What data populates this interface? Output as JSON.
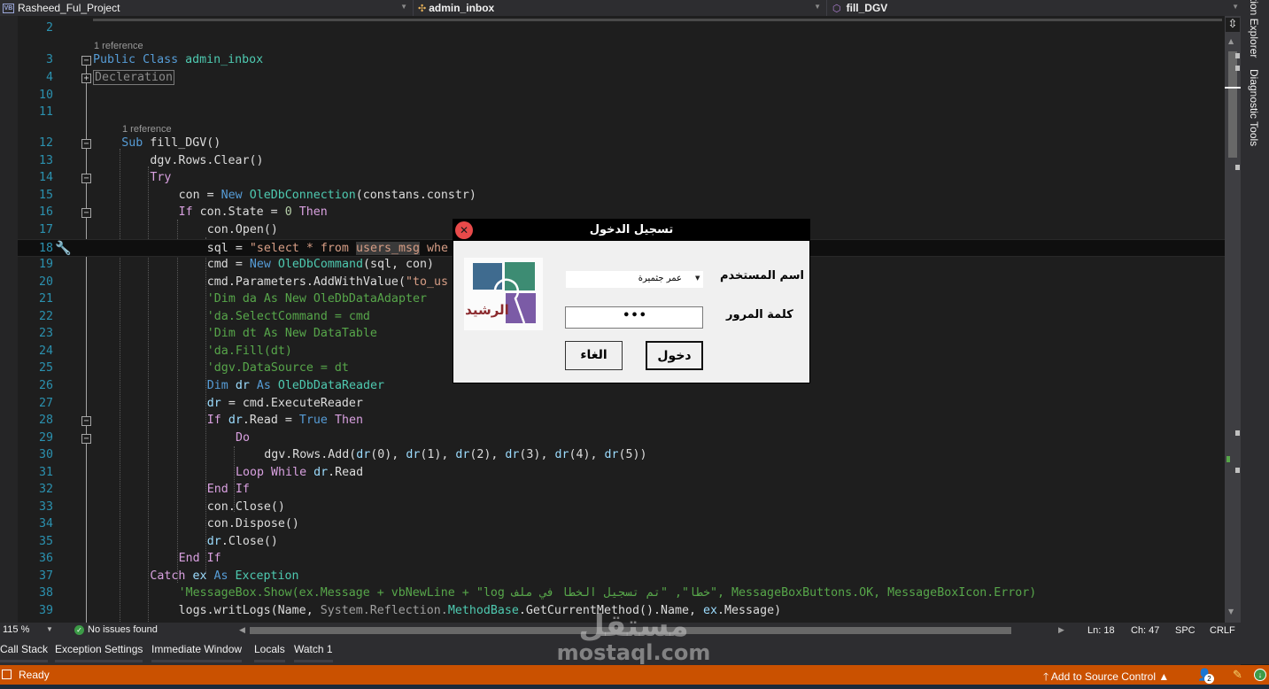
{
  "navbar": {
    "project": "Rasheed_Ful_Project",
    "class": "admin_inbox",
    "member": "fill_DGV"
  },
  "editor": {
    "lens_references": "1 reference",
    "lines": [
      {
        "n": "2"
      },
      {
        "n": "3",
        "tokens": [
          [
            "kw",
            "Public"
          ],
          [
            "plain",
            " "
          ],
          [
            "kw",
            "Class"
          ],
          [
            "plain",
            " "
          ],
          [
            "typ",
            "admin_inbox"
          ]
        ]
      },
      {
        "n": "4",
        "tokens": [
          [
            "collapsed",
            "Decleration"
          ]
        ]
      },
      {
        "n": "10"
      },
      {
        "n": "11"
      },
      {
        "n": "12",
        "tokens": [
          [
            "kw",
            "Sub"
          ],
          [
            "plain",
            " "
          ],
          [
            "plain",
            "fill_DGV()"
          ]
        ]
      },
      {
        "n": "13",
        "tokens": [
          [
            "plain",
            "dgv.Rows.Clear()"
          ]
        ]
      },
      {
        "n": "14",
        "tokens": [
          [
            "ctl",
            "Try"
          ]
        ]
      },
      {
        "n": "15",
        "tokens": [
          [
            "plain",
            "con = "
          ],
          [
            "kw",
            "New"
          ],
          [
            "plain",
            " "
          ],
          [
            "typ",
            "OleDbConnection"
          ],
          [
            "plain",
            "(constans.constr)"
          ]
        ]
      },
      {
        "n": "16",
        "tokens": [
          [
            "ctl",
            "If"
          ],
          [
            "plain",
            " con.State = "
          ],
          [
            "num",
            "0"
          ],
          [
            "plain",
            " "
          ],
          [
            "ctl",
            "Then"
          ]
        ]
      },
      {
        "n": "17",
        "tokens": [
          [
            "plain",
            "con.Open()"
          ]
        ]
      },
      {
        "n": "18",
        "tokens": [
          [
            "plain",
            "sql = "
          ],
          [
            "str",
            "\"select * from "
          ],
          [
            "str hl",
            "users_msg"
          ],
          [
            "str",
            " whe"
          ]
        ]
      },
      {
        "n": "19",
        "tokens": [
          [
            "plain",
            "cmd = "
          ],
          [
            "kw",
            "New"
          ],
          [
            "plain",
            " "
          ],
          [
            "typ",
            "OleDbCommand"
          ],
          [
            "plain",
            "(sql, con)"
          ]
        ]
      },
      {
        "n": "20",
        "tokens": [
          [
            "plain",
            "cmd.Parameters.AddWithValue("
          ],
          [
            "str",
            "\"to_us"
          ]
        ]
      },
      {
        "n": "21",
        "tokens": [
          [
            "cmt",
            "'Dim da As New OleDbDataAdapter"
          ]
        ]
      },
      {
        "n": "22",
        "tokens": [
          [
            "cmt",
            "'da.SelectCommand = cmd"
          ]
        ]
      },
      {
        "n": "23",
        "tokens": [
          [
            "cmt",
            "'Dim dt As New DataTable"
          ]
        ]
      },
      {
        "n": "24",
        "tokens": [
          [
            "cmt",
            "'da.Fill(dt)"
          ]
        ]
      },
      {
        "n": "25",
        "tokens": [
          [
            "cmt",
            "'dgv.DataSource = dt"
          ]
        ]
      },
      {
        "n": "26",
        "tokens": [
          [
            "kw",
            "Dim"
          ],
          [
            "plain",
            " "
          ],
          [
            "id",
            "dr"
          ],
          [
            "plain",
            " "
          ],
          [
            "kw",
            "As"
          ],
          [
            "plain",
            " "
          ],
          [
            "typ",
            "OleDbDataReader"
          ]
        ]
      },
      {
        "n": "27",
        "tokens": [
          [
            "id",
            "dr"
          ],
          [
            "plain",
            " = cmd.ExecuteReader"
          ]
        ]
      },
      {
        "n": "28",
        "tokens": [
          [
            "ctl",
            "If"
          ],
          [
            "plain",
            " "
          ],
          [
            "id",
            "dr"
          ],
          [
            "plain",
            ".Read = "
          ],
          [
            "kw",
            "True"
          ],
          [
            "plain",
            " "
          ],
          [
            "ctl",
            "Then"
          ]
        ]
      },
      {
        "n": "29",
        "tokens": [
          [
            "ctl",
            "Do"
          ]
        ]
      },
      {
        "n": "30",
        "tokens": [
          [
            "plain",
            "dgv.Rows.Add("
          ],
          [
            "id",
            "dr"
          ],
          [
            "plain",
            "(0), "
          ],
          [
            "id",
            "dr"
          ],
          [
            "plain",
            "(1), "
          ],
          [
            "id",
            "dr"
          ],
          [
            "plain",
            "(2), "
          ],
          [
            "id",
            "dr"
          ],
          [
            "plain",
            "(3), "
          ],
          [
            "id",
            "dr"
          ],
          [
            "plain",
            "(4), "
          ],
          [
            "id",
            "dr"
          ],
          [
            "plain",
            "(5))"
          ]
        ]
      },
      {
        "n": "31",
        "tokens": [
          [
            "ctl",
            "Loop"
          ],
          [
            "plain",
            " "
          ],
          [
            "ctl",
            "While"
          ],
          [
            "plain",
            " "
          ],
          [
            "id",
            "dr"
          ],
          [
            "plain",
            ".Read"
          ]
        ]
      },
      {
        "n": "32",
        "tokens": [
          [
            "ctl",
            "End"
          ],
          [
            "plain",
            " "
          ],
          [
            "ctl",
            "If"
          ]
        ]
      },
      {
        "n": "33",
        "tokens": [
          [
            "plain",
            "con.Close()"
          ]
        ]
      },
      {
        "n": "34",
        "tokens": [
          [
            "plain",
            "con.Dispose()"
          ]
        ]
      },
      {
        "n": "35",
        "tokens": [
          [
            "id",
            "dr"
          ],
          [
            "plain",
            ".Close()"
          ]
        ]
      },
      {
        "n": "36",
        "tokens": [
          [
            "ctl",
            "End"
          ],
          [
            "plain",
            " "
          ],
          [
            "ctl",
            "If"
          ]
        ]
      },
      {
        "n": "37",
        "tokens": [
          [
            "ctl",
            "Catch"
          ],
          [
            "plain",
            " "
          ],
          [
            "id",
            "ex"
          ],
          [
            "plain",
            " "
          ],
          [
            "kw",
            "As"
          ],
          [
            "plain",
            " "
          ],
          [
            "typ",
            "Exception"
          ]
        ]
      },
      {
        "n": "38",
        "tokens": [
          [
            "cmt",
            "'MessageBox.Show(ex.Message + vbNewLine + \"log خطا\", \"تم تسجيل الخطا في ملف\", MessageBoxButtons.OK, MessageBoxIcon.Error)"
          ]
        ]
      },
      {
        "n": "39",
        "tokens": [
          [
            "plain",
            "logs.writLogs(Name, "
          ],
          [
            "grey",
            "System.Reflection."
          ],
          [
            "typ",
            "MethodBase"
          ],
          [
            "plain",
            ".GetCurrentMethod().Name, "
          ],
          [
            "id",
            "ex"
          ],
          [
            "plain",
            ".Message)"
          ]
        ]
      }
    ]
  },
  "side_tabs": {
    "solution_explorer": "tion Explorer",
    "diagnostic_tools": "Diagnostic Tools"
  },
  "editor_bottom": {
    "zoom": "115 %",
    "issues": "No issues found",
    "line": "Ln: 18",
    "char": "Ch: 47",
    "indent": "SPC",
    "line_ending": "CRLF"
  },
  "tool_tabs": [
    "Call Stack",
    "Exception Settings",
    "Immediate Window",
    "Locals",
    "Watch 1"
  ],
  "statusbar": {
    "ready": "Ready",
    "source_control": "Add to Source Control",
    "notifications_count": "2",
    "accent": "#ca5100"
  },
  "dialog": {
    "title": "تسجيل الدخول",
    "close_glyph": "✕",
    "logo_text": "الرشيد",
    "username_label": "اسم المستخدم",
    "username_value": "عمر جثميرة",
    "password_label": "كلمة المرور",
    "password_value": "•••",
    "login_button": "دخول",
    "cancel_button": "الغاء"
  },
  "watermark": {
    "arabic": "مستقل",
    "latin": "mostaql.com"
  }
}
